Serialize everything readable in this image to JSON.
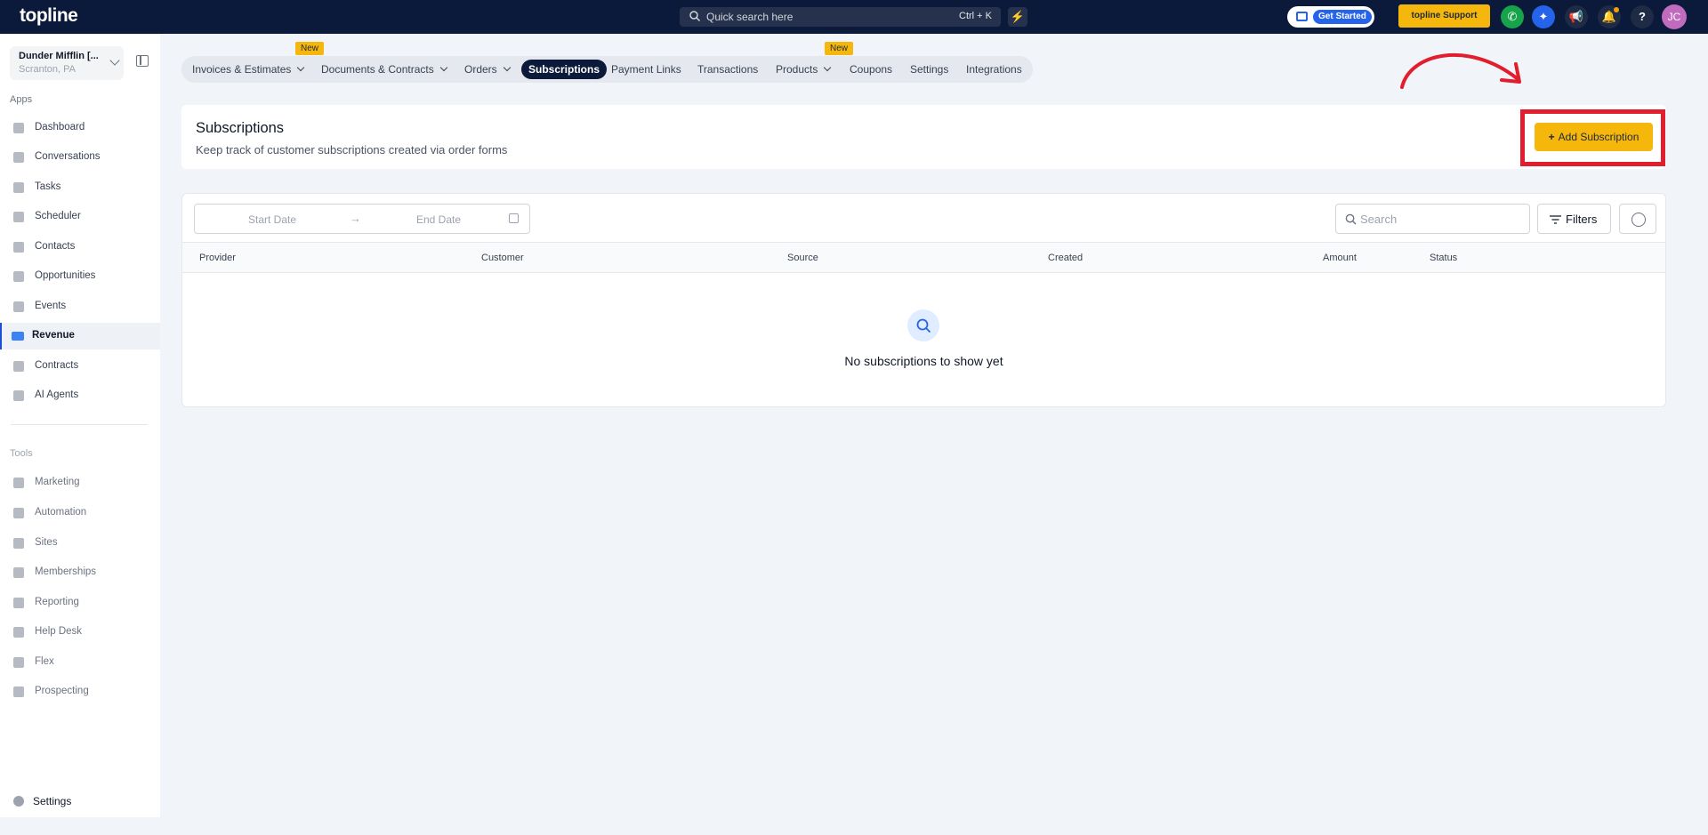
{
  "topbar": {
    "logo": "topline",
    "search_placeholder": "Quick search here",
    "search_shortcut": "Ctrl + K",
    "get_started": "Get Started",
    "support": "topline Support",
    "avatar": "JC",
    "help": "?"
  },
  "sidebar": {
    "account_name": "Dunder Mifflin [...",
    "account_location": "Scranton, PA",
    "apps_label": "Apps",
    "apps": [
      {
        "label": "Dashboard"
      },
      {
        "label": "Conversations"
      },
      {
        "label": "Tasks"
      },
      {
        "label": "Scheduler"
      },
      {
        "label": "Contacts"
      },
      {
        "label": "Opportunities"
      },
      {
        "label": "Events"
      },
      {
        "label": "Revenue"
      },
      {
        "label": "Contracts"
      },
      {
        "label": "AI Agents"
      }
    ],
    "tools_label": "Tools",
    "tools": [
      {
        "label": "Marketing"
      },
      {
        "label": "Automation"
      },
      {
        "label": "Sites"
      },
      {
        "label": "Memberships"
      },
      {
        "label": "Reporting"
      },
      {
        "label": "Help Desk"
      },
      {
        "label": "Flex"
      },
      {
        "label": "Prospecting"
      }
    ],
    "settings": "Settings"
  },
  "tabs": {
    "items": [
      {
        "label": "Invoices & Estimates"
      },
      {
        "label": "Documents & Contracts"
      },
      {
        "label": "Orders"
      },
      {
        "label": "Subscriptions"
      },
      {
        "label": "Payment Links"
      },
      {
        "label": "Transactions"
      },
      {
        "label": "Products"
      },
      {
        "label": "Coupons"
      },
      {
        "label": "Settings"
      },
      {
        "label": "Integrations"
      }
    ],
    "new_badge": "New"
  },
  "header": {
    "title": "Subscriptions",
    "subtitle": "Keep track of customer subscriptions created via order forms",
    "add_button": "Add Subscription"
  },
  "table": {
    "start_date": "Start Date",
    "end_date": "End Date",
    "search_placeholder": "Search",
    "filters": "Filters",
    "columns": [
      "Provider",
      "Customer",
      "Source",
      "Created",
      "Amount",
      "Status"
    ],
    "empty_text": "No subscriptions to show yet"
  },
  "colors": {
    "topbar": "#0b1a3a",
    "accent": "#f5b70b",
    "annotation": "#e11d2e"
  }
}
